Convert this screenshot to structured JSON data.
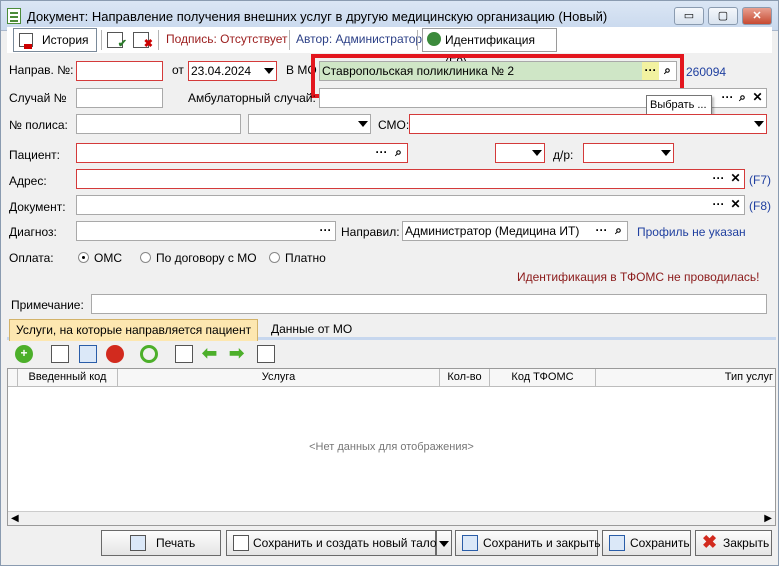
{
  "window": {
    "title": "Документ: Направление получения внешних услуг в другую медицинскую организацию (Новый)",
    "minimize": "▭",
    "maximize": "▢",
    "close": "✕"
  },
  "toolbar": {
    "history_label": "История",
    "signature_label": "Подпись: Отсутствует",
    "author_label": "Автор: Администратор",
    "identification_label": "Идентификация  (F9)"
  },
  "form": {
    "naprav_no_label": "Направ. №:",
    "naprav_no_value": "",
    "ot_label": "от",
    "date_value": "23.04.2024",
    "v_mo_label": "В МО",
    "mo_value": "Ставропольская поликлиника № 2",
    "mo_code": "260094",
    "sluchay_label": "Случай №",
    "sluchay_value": "",
    "ambul_label": "Амбулаторный случай:",
    "ambul_value": "",
    "polis_label": "№ полиса:",
    "polis_value": "",
    "polis_type_value": "",
    "smo_label": "СМО:",
    "smo_value": "",
    "patient_label": "Пациент:",
    "patient_value": "",
    "sex_value": "",
    "dr_label": "д/р:",
    "dr_value": "",
    "address_label": "Адрес:",
    "address_value": "",
    "address_hotkey": "(F7)",
    "document_label": "Документ:",
    "document_value": "",
    "document_hotkey": "(F8)",
    "diagnosis_label": "Диагноз:",
    "diagnosis_value": "",
    "napravil_label": "Направил:",
    "napravil_value": "Администратор (Медицина ИТ)",
    "profile_link": "Профиль не указан",
    "payment_label": "Оплата:",
    "payment_options": [
      "ОМС",
      "По договору с МО",
      "Платно"
    ],
    "payment_selected": "ОМС",
    "tfoms_warning": "Идентификация в ТФОМС не проводилась!",
    "note_label": "Примечание:",
    "note_value": ""
  },
  "tooltip": "Выбрать ...",
  "tabs": [
    "Услуги, на которые направляется пациент",
    "Данные от МО"
  ],
  "grid": {
    "columns": [
      "Введенный код",
      "Услуга",
      "Кол-во",
      "Код ТФОМС",
      "Тип услуг"
    ],
    "empty_text": "<Нет данных для отображения>"
  },
  "buttons": {
    "print": "Печать",
    "save_new": "Сохранить и создать новый талон",
    "save_close": "Сохранить и закрыть",
    "save": "Сохранить",
    "close": "Закрыть"
  },
  "colors": {
    "highlight": "#e3161e",
    "link": "#2040a0",
    "warning": "#8b1a1a",
    "active_tab": "#fde7b0",
    "mo_field": "#cfe6c6"
  }
}
